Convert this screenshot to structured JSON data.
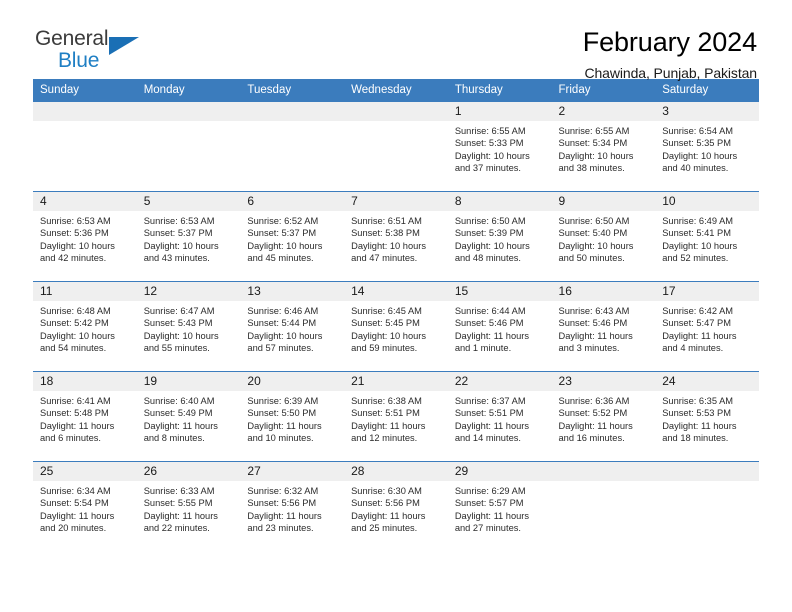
{
  "brand": {
    "name_part1": "General",
    "name_part2": "Blue",
    "triangle_color": "#1a6fb5",
    "blue": "#1f7fc4"
  },
  "header": {
    "title": "February 2024",
    "subtitle": "Chawinda, Punjab, Pakistan"
  },
  "theme": {
    "header_bg": "#3b7cbd",
    "daynum_bg": "#efefef",
    "grid_line": "#3b7cbd"
  },
  "weekdays": [
    "Sunday",
    "Monday",
    "Tuesday",
    "Wednesday",
    "Thursday",
    "Friday",
    "Saturday"
  ],
  "labels": {
    "sunrise_prefix": "Sunrise:",
    "sunset_prefix": "Sunset:",
    "daylight_prefix": "Daylight:"
  },
  "weeks": [
    [
      {
        "day": "",
        "empty": true
      },
      {
        "day": "",
        "empty": true
      },
      {
        "day": "",
        "empty": true
      },
      {
        "day": "",
        "empty": true
      },
      {
        "day": "1",
        "sunrise": "Sunrise: 6:55 AM",
        "sunset": "Sunset: 5:33 PM",
        "daylight_l1": "Daylight: 10 hours",
        "daylight_l2": "and 37 minutes."
      },
      {
        "day": "2",
        "sunrise": "Sunrise: 6:55 AM",
        "sunset": "Sunset: 5:34 PM",
        "daylight_l1": "Daylight: 10 hours",
        "daylight_l2": "and 38 minutes."
      },
      {
        "day": "3",
        "sunrise": "Sunrise: 6:54 AM",
        "sunset": "Sunset: 5:35 PM",
        "daylight_l1": "Daylight: 10 hours",
        "daylight_l2": "and 40 minutes."
      }
    ],
    [
      {
        "day": "4",
        "sunrise": "Sunrise: 6:53 AM",
        "sunset": "Sunset: 5:36 PM",
        "daylight_l1": "Daylight: 10 hours",
        "daylight_l2": "and 42 minutes."
      },
      {
        "day": "5",
        "sunrise": "Sunrise: 6:53 AM",
        "sunset": "Sunset: 5:37 PM",
        "daylight_l1": "Daylight: 10 hours",
        "daylight_l2": "and 43 minutes."
      },
      {
        "day": "6",
        "sunrise": "Sunrise: 6:52 AM",
        "sunset": "Sunset: 5:37 PM",
        "daylight_l1": "Daylight: 10 hours",
        "daylight_l2": "and 45 minutes."
      },
      {
        "day": "7",
        "sunrise": "Sunrise: 6:51 AM",
        "sunset": "Sunset: 5:38 PM",
        "daylight_l1": "Daylight: 10 hours",
        "daylight_l2": "and 47 minutes."
      },
      {
        "day": "8",
        "sunrise": "Sunrise: 6:50 AM",
        "sunset": "Sunset: 5:39 PM",
        "daylight_l1": "Daylight: 10 hours",
        "daylight_l2": "and 48 minutes."
      },
      {
        "day": "9",
        "sunrise": "Sunrise: 6:50 AM",
        "sunset": "Sunset: 5:40 PM",
        "daylight_l1": "Daylight: 10 hours",
        "daylight_l2": "and 50 minutes."
      },
      {
        "day": "10",
        "sunrise": "Sunrise: 6:49 AM",
        "sunset": "Sunset: 5:41 PM",
        "daylight_l1": "Daylight: 10 hours",
        "daylight_l2": "and 52 minutes."
      }
    ],
    [
      {
        "day": "11",
        "sunrise": "Sunrise: 6:48 AM",
        "sunset": "Sunset: 5:42 PM",
        "daylight_l1": "Daylight: 10 hours",
        "daylight_l2": "and 54 minutes."
      },
      {
        "day": "12",
        "sunrise": "Sunrise: 6:47 AM",
        "sunset": "Sunset: 5:43 PM",
        "daylight_l1": "Daylight: 10 hours",
        "daylight_l2": "and 55 minutes."
      },
      {
        "day": "13",
        "sunrise": "Sunrise: 6:46 AM",
        "sunset": "Sunset: 5:44 PM",
        "daylight_l1": "Daylight: 10 hours",
        "daylight_l2": "and 57 minutes."
      },
      {
        "day": "14",
        "sunrise": "Sunrise: 6:45 AM",
        "sunset": "Sunset: 5:45 PM",
        "daylight_l1": "Daylight: 10 hours",
        "daylight_l2": "and 59 minutes."
      },
      {
        "day": "15",
        "sunrise": "Sunrise: 6:44 AM",
        "sunset": "Sunset: 5:46 PM",
        "daylight_l1": "Daylight: 11 hours",
        "daylight_l2": "and 1 minute."
      },
      {
        "day": "16",
        "sunrise": "Sunrise: 6:43 AM",
        "sunset": "Sunset: 5:46 PM",
        "daylight_l1": "Daylight: 11 hours",
        "daylight_l2": "and 3 minutes."
      },
      {
        "day": "17",
        "sunrise": "Sunrise: 6:42 AM",
        "sunset": "Sunset: 5:47 PM",
        "daylight_l1": "Daylight: 11 hours",
        "daylight_l2": "and 4 minutes."
      }
    ],
    [
      {
        "day": "18",
        "sunrise": "Sunrise: 6:41 AM",
        "sunset": "Sunset: 5:48 PM",
        "daylight_l1": "Daylight: 11 hours",
        "daylight_l2": "and 6 minutes."
      },
      {
        "day": "19",
        "sunrise": "Sunrise: 6:40 AM",
        "sunset": "Sunset: 5:49 PM",
        "daylight_l1": "Daylight: 11 hours",
        "daylight_l2": "and 8 minutes."
      },
      {
        "day": "20",
        "sunrise": "Sunrise: 6:39 AM",
        "sunset": "Sunset: 5:50 PM",
        "daylight_l1": "Daylight: 11 hours",
        "daylight_l2": "and 10 minutes."
      },
      {
        "day": "21",
        "sunrise": "Sunrise: 6:38 AM",
        "sunset": "Sunset: 5:51 PM",
        "daylight_l1": "Daylight: 11 hours",
        "daylight_l2": "and 12 minutes."
      },
      {
        "day": "22",
        "sunrise": "Sunrise: 6:37 AM",
        "sunset": "Sunset: 5:51 PM",
        "daylight_l1": "Daylight: 11 hours",
        "daylight_l2": "and 14 minutes."
      },
      {
        "day": "23",
        "sunrise": "Sunrise: 6:36 AM",
        "sunset": "Sunset: 5:52 PM",
        "daylight_l1": "Daylight: 11 hours",
        "daylight_l2": "and 16 minutes."
      },
      {
        "day": "24",
        "sunrise": "Sunrise: 6:35 AM",
        "sunset": "Sunset: 5:53 PM",
        "daylight_l1": "Daylight: 11 hours",
        "daylight_l2": "and 18 minutes."
      }
    ],
    [
      {
        "day": "25",
        "sunrise": "Sunrise: 6:34 AM",
        "sunset": "Sunset: 5:54 PM",
        "daylight_l1": "Daylight: 11 hours",
        "daylight_l2": "and 20 minutes."
      },
      {
        "day": "26",
        "sunrise": "Sunrise: 6:33 AM",
        "sunset": "Sunset: 5:55 PM",
        "daylight_l1": "Daylight: 11 hours",
        "daylight_l2": "and 22 minutes."
      },
      {
        "day": "27",
        "sunrise": "Sunrise: 6:32 AM",
        "sunset": "Sunset: 5:56 PM",
        "daylight_l1": "Daylight: 11 hours",
        "daylight_l2": "and 23 minutes."
      },
      {
        "day": "28",
        "sunrise": "Sunrise: 6:30 AM",
        "sunset": "Sunset: 5:56 PM",
        "daylight_l1": "Daylight: 11 hours",
        "daylight_l2": "and 25 minutes."
      },
      {
        "day": "29",
        "sunrise": "Sunrise: 6:29 AM",
        "sunset": "Sunset: 5:57 PM",
        "daylight_l1": "Daylight: 11 hours",
        "daylight_l2": "and 27 minutes."
      },
      {
        "day": "",
        "empty": true
      },
      {
        "day": "",
        "empty": true
      }
    ]
  ]
}
